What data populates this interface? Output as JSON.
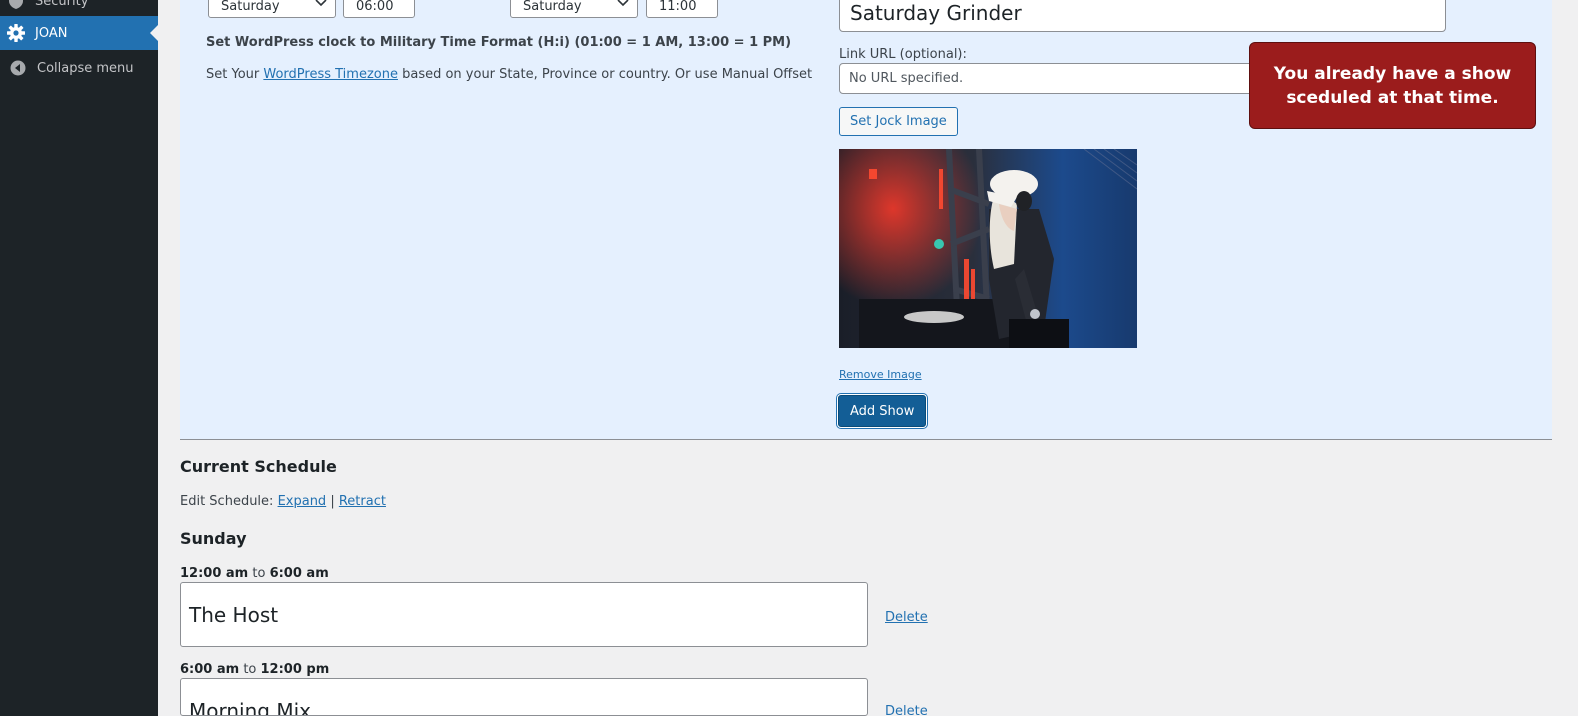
{
  "sidebar": {
    "security_label": "Security",
    "joan_label": "JOAN",
    "collapse_label": "Collapse menu"
  },
  "form": {
    "start_day": "Saturday",
    "start_time": "06:00",
    "end_day": "Saturday",
    "end_time": "11:00",
    "help_military": "Set WordPress clock to Military Time Format (H:i) (01:00 = 1 AM, 13:00 = 1 PM)",
    "help_tz_prefix": "Set Your ",
    "help_tz_link": "WordPress Timezone",
    "help_tz_suffix": " based on your State, Province or country. Or use Manual Offset",
    "show_title": "Saturday Grinder",
    "link_label": "Link URL (optional):",
    "link_placeholder": "No URL specified.",
    "set_image_button": "Set Jock Image",
    "remove_image_link": "Remove Image",
    "add_show_button": "Add Show"
  },
  "alert": {
    "message": "You already have a show sceduled at that time."
  },
  "schedule": {
    "heading": "Current Schedule",
    "edit_label": "Edit Schedule: ",
    "expand_link": "Expand",
    "separator": " | ",
    "retract_link": "Retract",
    "day": "Sunday",
    "to_word": " to ",
    "slots": [
      {
        "start": "12:00 am",
        "end": "6:00 am",
        "name": "The Host",
        "delete": "Delete"
      },
      {
        "start": "6:00 am",
        "end": "12:00 pm",
        "name": "Morning Mix",
        "delete": "Delete"
      }
    ]
  },
  "colors": {
    "sidebar_bg": "#1d2327",
    "active_menu": "#2271b1",
    "panel_bg": "#e5f0fe",
    "alert_bg": "#9b1c1c",
    "primary_button": "#135e96"
  }
}
